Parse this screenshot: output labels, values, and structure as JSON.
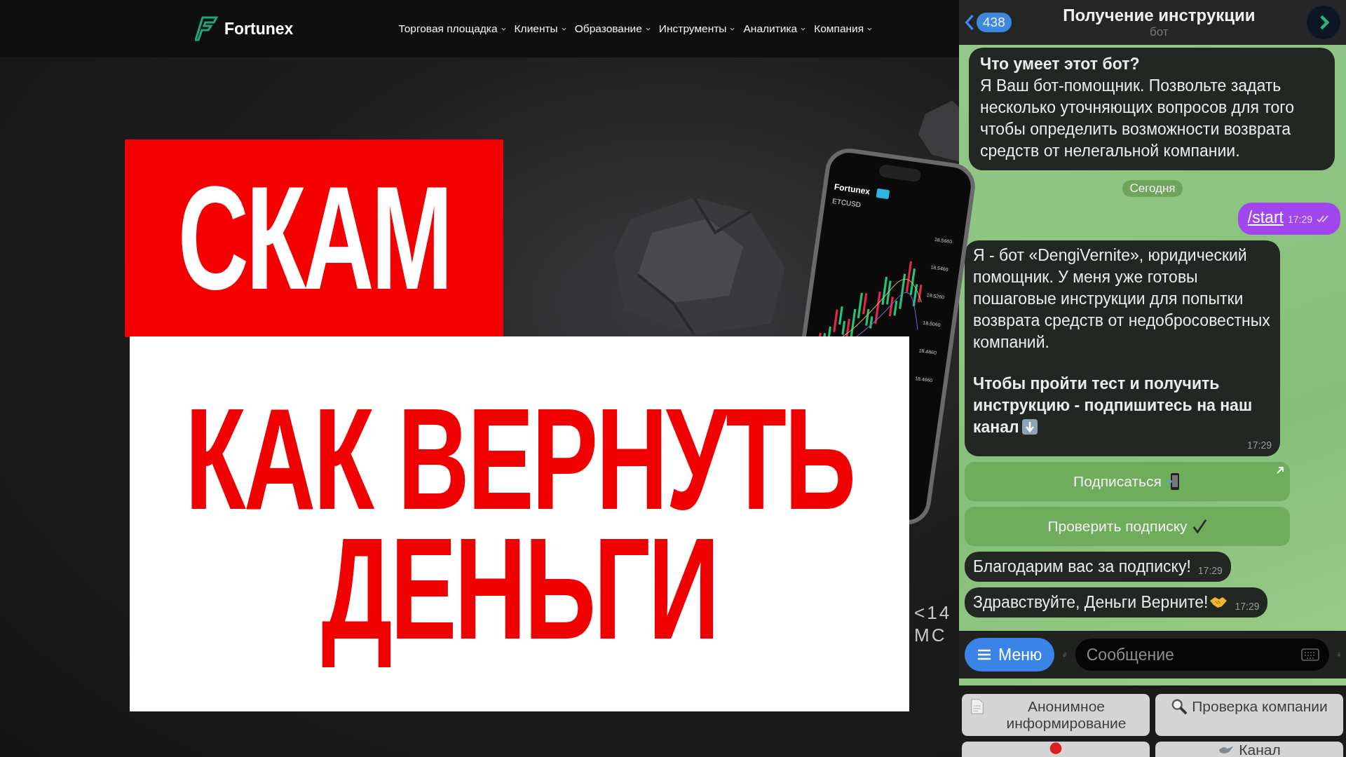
{
  "site": {
    "logo": "Fortunex",
    "nav": [
      {
        "label": "Торговая площадка",
        "dropdown": true
      },
      {
        "label": "Клиенты",
        "dropdown": true
      },
      {
        "label": "Образование",
        "dropdown": true
      },
      {
        "label": "Инструменты",
        "dropdown": true
      },
      {
        "label": "Аналитика",
        "dropdown": true
      },
      {
        "label": "Компания",
        "dropdown": true
      }
    ]
  },
  "overlay": {
    "title": "СКАМ",
    "subtitle_lines": [
      "КАК ВЕРНУТЬ",
      "ДЕНЬГИ"
    ]
  },
  "phone": {
    "brand": "Fortunex",
    "symbol": "ETCUSD",
    "price_labels": [
      "18.5660",
      "18.5460",
      "18.5260",
      "18.5060",
      "18.4860",
      "18.4660"
    ]
  },
  "corner_note": [
    "<14",
    "МС"
  ],
  "telegram": {
    "back_count": "438",
    "title": "Получение инструкции",
    "subtitle": "бот",
    "messages": [
      {
        "kind": "intro",
        "heading": "Что умеет этот бот?",
        "text": "Я Ваш бот-помощник. Позвольте задать несколько уточняющих вопросов для того чтобы определить возможности возврата средств от нелегальной компании."
      },
      {
        "kind": "date",
        "text": "Сегодня"
      },
      {
        "kind": "outgoing",
        "text": "/start",
        "time": "17:29",
        "read": true
      },
      {
        "kind": "incoming",
        "paragraphs": [
          {
            "text": "Я - бот «DengiVernite», юридический помощник. У меня уже готовы пошаговые инструкции для попытки возврата средств от недобросовестных компаний.",
            "bold": false
          },
          {
            "text": "Чтобы пройти тест и получить инструкцию - подпишитесь на наш канал",
            "bold": true
          }
        ],
        "time": "17:29"
      },
      {
        "kind": "button",
        "text": "Подписаться",
        "link": true
      },
      {
        "kind": "button",
        "text": "Проверить подписку",
        "link": false
      },
      {
        "kind": "incoming",
        "paragraphs": [
          {
            "text": "Благодарим вас за подписку!",
            "bold": false
          }
        ],
        "time": "17:29"
      },
      {
        "kind": "incoming",
        "paragraphs": [
          {
            "text": "Здравствуйте, Деньги Верните!",
            "bold": false
          }
        ],
        "time": "17:29"
      }
    ],
    "menu_button": "Меню",
    "input": {
      "placeholder": "Сообщение"
    },
    "keyboard": [
      {
        "kind": "text",
        "label": "Анонимное информирование"
      },
      {
        "kind": "text",
        "label": "Проверка компании"
      },
      {
        "kind": "icon"
      },
      {
        "kind": "text",
        "label": "Канал"
      }
    ]
  }
}
